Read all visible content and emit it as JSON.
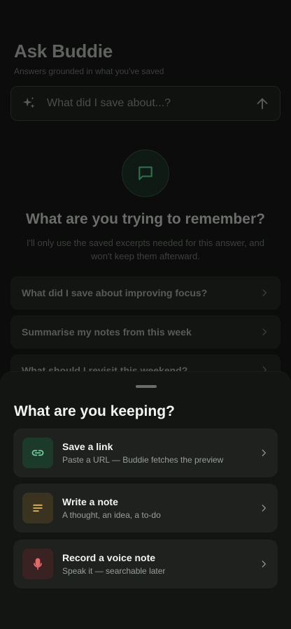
{
  "header": {
    "title": "Ask Buddie",
    "subtitle": "Answers grounded in what you've saved"
  },
  "ask": {
    "placeholder": "What did I save about...?",
    "icon": "sparkle-icon",
    "send_icon": "arrow-up-icon"
  },
  "empty_state": {
    "icon": "chat-bubble-icon",
    "title": "What are you trying to remember?",
    "body": "I'll only use the saved excerpts needed for this answer, and won't keep them afterward."
  },
  "suggestions": [
    {
      "label": "What did I save about improving focus?"
    },
    {
      "label": "Summarise my notes from this week"
    },
    {
      "label": "What should I revisit this weekend?"
    }
  ],
  "sheet": {
    "title": "What are you keeping?",
    "options": [
      {
        "title": "Save a link",
        "subtitle": "Paste a URL — Buddie fetches the preview",
        "icon": "link-icon",
        "color": "#6fc796",
        "tile": "#1c3a2a"
      },
      {
        "title": "Write a note",
        "subtitle": "A thought, an idea, a to-do",
        "icon": "note-lines-icon",
        "color": "#e2b45a",
        "tile": "#3a3320"
      },
      {
        "title": "Record a voice note",
        "subtitle": "Speak it — searchable later",
        "icon": "microphone-icon",
        "color": "#e36a6a",
        "tile": "#3a2122"
      }
    ]
  }
}
